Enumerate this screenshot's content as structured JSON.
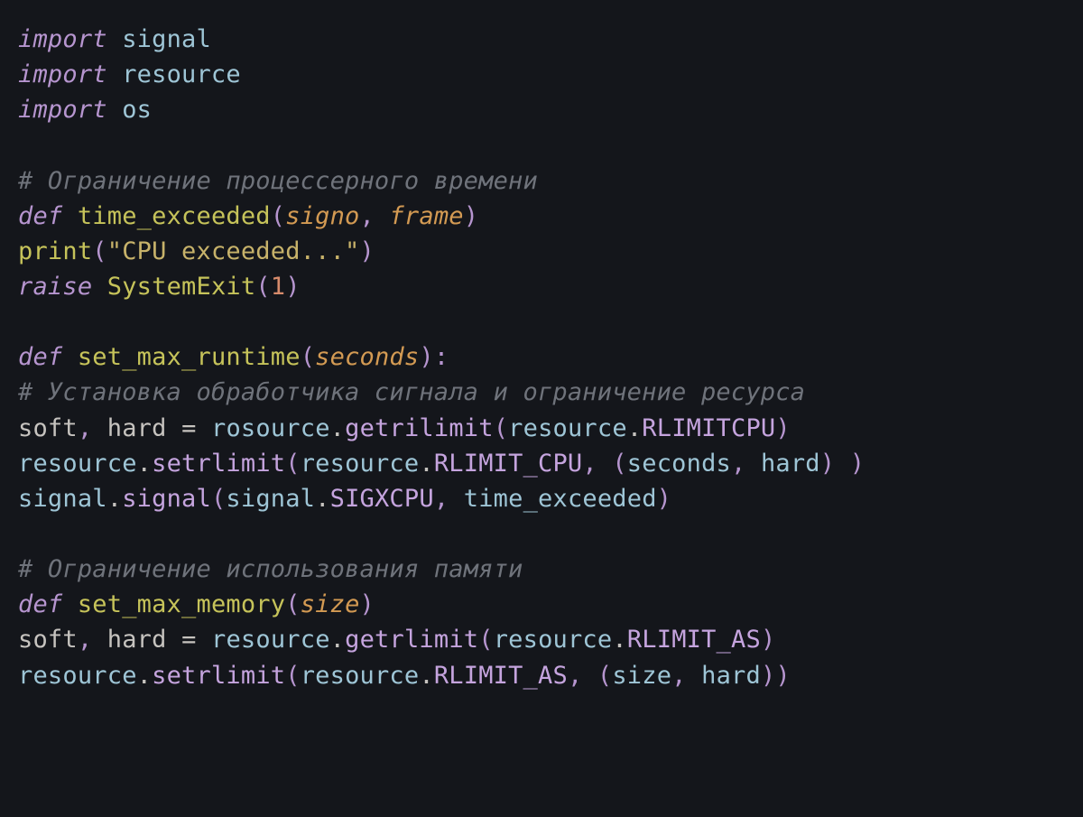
{
  "code": {
    "lines": [
      {
        "t": [
          {
            "c": "tok-kw",
            "v": "import"
          },
          {
            "c": "sp",
            "v": " "
          },
          {
            "c": "tok-mod",
            "v": "signal"
          }
        ]
      },
      {
        "t": [
          {
            "c": "tok-kw",
            "v": "import"
          },
          {
            "c": "sp",
            "v": " "
          },
          {
            "c": "tok-mod",
            "v": "resource"
          }
        ]
      },
      {
        "t": [
          {
            "c": "tok-kw",
            "v": "import"
          },
          {
            "c": "sp",
            "v": " "
          },
          {
            "c": "tok-mod",
            "v": "os"
          }
        ]
      },
      {
        "t": []
      },
      {
        "t": [
          {
            "c": "tok-comment",
            "v": "# Ограничение процессерного времени"
          }
        ]
      },
      {
        "t": [
          {
            "c": "tok-kw",
            "v": "def"
          },
          {
            "c": "sp",
            "v": " "
          },
          {
            "c": "tok-func",
            "v": "time_exceeded"
          },
          {
            "c": "tok-punct",
            "v": "("
          },
          {
            "c": "tok-param",
            "v": "signo"
          },
          {
            "c": "tok-punct",
            "v": ","
          },
          {
            "c": "sp",
            "v": " "
          },
          {
            "c": "tok-param",
            "v": "frame"
          },
          {
            "c": "tok-punct",
            "v": ")"
          }
        ]
      },
      {
        "t": [
          {
            "c": "tok-builtin",
            "v": "print"
          },
          {
            "c": "tok-punct",
            "v": "("
          },
          {
            "c": "tok-str",
            "v": "\"CPU exceeded...\""
          },
          {
            "c": "tok-punct",
            "v": ")"
          }
        ]
      },
      {
        "t": [
          {
            "c": "tok-kw",
            "v": "raise"
          },
          {
            "c": "sp",
            "v": " "
          },
          {
            "c": "tok-class",
            "v": "SystemExit"
          },
          {
            "c": "tok-punct",
            "v": "("
          },
          {
            "c": "tok-num",
            "v": "1"
          },
          {
            "c": "tok-punct",
            "v": ")"
          }
        ]
      },
      {
        "t": []
      },
      {
        "t": [
          {
            "c": "tok-kw",
            "v": "def"
          },
          {
            "c": "sp",
            "v": " "
          },
          {
            "c": "tok-func",
            "v": "set_max_runtime"
          },
          {
            "c": "tok-punct",
            "v": "("
          },
          {
            "c": "tok-param",
            "v": "seconds"
          },
          {
            "c": "tok-punct",
            "v": "):"
          }
        ]
      },
      {
        "t": [
          {
            "c": "tok-comment",
            "v": "# Установка обработчика сигнала и ограничение ресурса"
          }
        ]
      },
      {
        "t": [
          {
            "c": "tok-var",
            "v": "soft"
          },
          {
            "c": "tok-punct",
            "v": ","
          },
          {
            "c": "sp",
            "v": " "
          },
          {
            "c": "tok-var",
            "v": "hard"
          },
          {
            "c": "sp",
            "v": " "
          },
          {
            "c": "tok-op",
            "v": "="
          },
          {
            "c": "sp",
            "v": " "
          },
          {
            "c": "tok-mod",
            "v": "rosource"
          },
          {
            "c": "tok-dot",
            "v": "."
          },
          {
            "c": "tok-attr",
            "v": "getrilimit"
          },
          {
            "c": "tok-punct",
            "v": "("
          },
          {
            "c": "tok-mod",
            "v": "resource"
          },
          {
            "c": "tok-dot",
            "v": "."
          },
          {
            "c": "tok-attr",
            "v": "RLIMITCPU"
          },
          {
            "c": "tok-punct",
            "v": ")"
          }
        ]
      },
      {
        "t": [
          {
            "c": "tok-mod",
            "v": "resource"
          },
          {
            "c": "tok-dot",
            "v": "."
          },
          {
            "c": "tok-attr",
            "v": "setrlimit"
          },
          {
            "c": "tok-punct",
            "v": "("
          },
          {
            "c": "tok-mod",
            "v": "resource"
          },
          {
            "c": "tok-dot",
            "v": "."
          },
          {
            "c": "tok-attr",
            "v": "RLIMIT_CPU"
          },
          {
            "c": "tok-punct",
            "v": ","
          },
          {
            "c": "sp",
            "v": " "
          },
          {
            "c": "tok-punct",
            "v": "("
          },
          {
            "c": "tok-mod",
            "v": "seconds"
          },
          {
            "c": "tok-punct",
            "v": ","
          },
          {
            "c": "sp",
            "v": " "
          },
          {
            "c": "tok-mod",
            "v": "hard"
          },
          {
            "c": "tok-punct",
            "v": ")"
          },
          {
            "c": "sp",
            "v": " "
          },
          {
            "c": "tok-punct",
            "v": ")"
          }
        ]
      },
      {
        "t": [
          {
            "c": "tok-mod",
            "v": "signal"
          },
          {
            "c": "tok-dot",
            "v": "."
          },
          {
            "c": "tok-attr",
            "v": "signal"
          },
          {
            "c": "tok-punct",
            "v": "("
          },
          {
            "c": "tok-mod",
            "v": "signal"
          },
          {
            "c": "tok-dot",
            "v": "."
          },
          {
            "c": "tok-attr",
            "v": "SIGXCPU"
          },
          {
            "c": "tok-punct",
            "v": ","
          },
          {
            "c": "sp",
            "v": " "
          },
          {
            "c": "tok-mod",
            "v": "time_exceeded"
          },
          {
            "c": "tok-punct",
            "v": ")"
          }
        ]
      },
      {
        "t": []
      },
      {
        "t": [
          {
            "c": "tok-comment",
            "v": "# Ограничение использования памяти"
          }
        ]
      },
      {
        "t": [
          {
            "c": "tok-kw",
            "v": "def"
          },
          {
            "c": "sp",
            "v": " "
          },
          {
            "c": "tok-func",
            "v": "set_max_memory"
          },
          {
            "c": "tok-punct",
            "v": "("
          },
          {
            "c": "tok-param",
            "v": "size"
          },
          {
            "c": "tok-punct",
            "v": ")"
          }
        ]
      },
      {
        "t": [
          {
            "c": "tok-var",
            "v": "soft"
          },
          {
            "c": "tok-punct",
            "v": ","
          },
          {
            "c": "sp",
            "v": " "
          },
          {
            "c": "tok-var",
            "v": "hard"
          },
          {
            "c": "sp",
            "v": " "
          },
          {
            "c": "tok-op",
            "v": "="
          },
          {
            "c": "sp",
            "v": " "
          },
          {
            "c": "tok-mod",
            "v": "resource"
          },
          {
            "c": "tok-dot",
            "v": "."
          },
          {
            "c": "tok-attr",
            "v": "getrlimit"
          },
          {
            "c": "tok-punct",
            "v": "("
          },
          {
            "c": "tok-mod",
            "v": "resource"
          },
          {
            "c": "tok-dot",
            "v": "."
          },
          {
            "c": "tok-attr",
            "v": "RLIMIT_AS"
          },
          {
            "c": "tok-punct",
            "v": ")"
          }
        ]
      },
      {
        "t": [
          {
            "c": "tok-mod",
            "v": "resource"
          },
          {
            "c": "tok-dot",
            "v": "."
          },
          {
            "c": "tok-attr",
            "v": "setrlimit"
          },
          {
            "c": "tok-punct",
            "v": "("
          },
          {
            "c": "tok-mod",
            "v": "resource"
          },
          {
            "c": "tok-dot",
            "v": "."
          },
          {
            "c": "tok-attr",
            "v": "RLIMIT_AS"
          },
          {
            "c": "tok-punct",
            "v": ","
          },
          {
            "c": "sp",
            "v": " "
          },
          {
            "c": "tok-punct",
            "v": "("
          },
          {
            "c": "tok-mod",
            "v": "size"
          },
          {
            "c": "tok-punct",
            "v": ","
          },
          {
            "c": "sp",
            "v": " "
          },
          {
            "c": "tok-mod",
            "v": "hard"
          },
          {
            "c": "tok-punct",
            "v": "))"
          }
        ]
      }
    ]
  }
}
